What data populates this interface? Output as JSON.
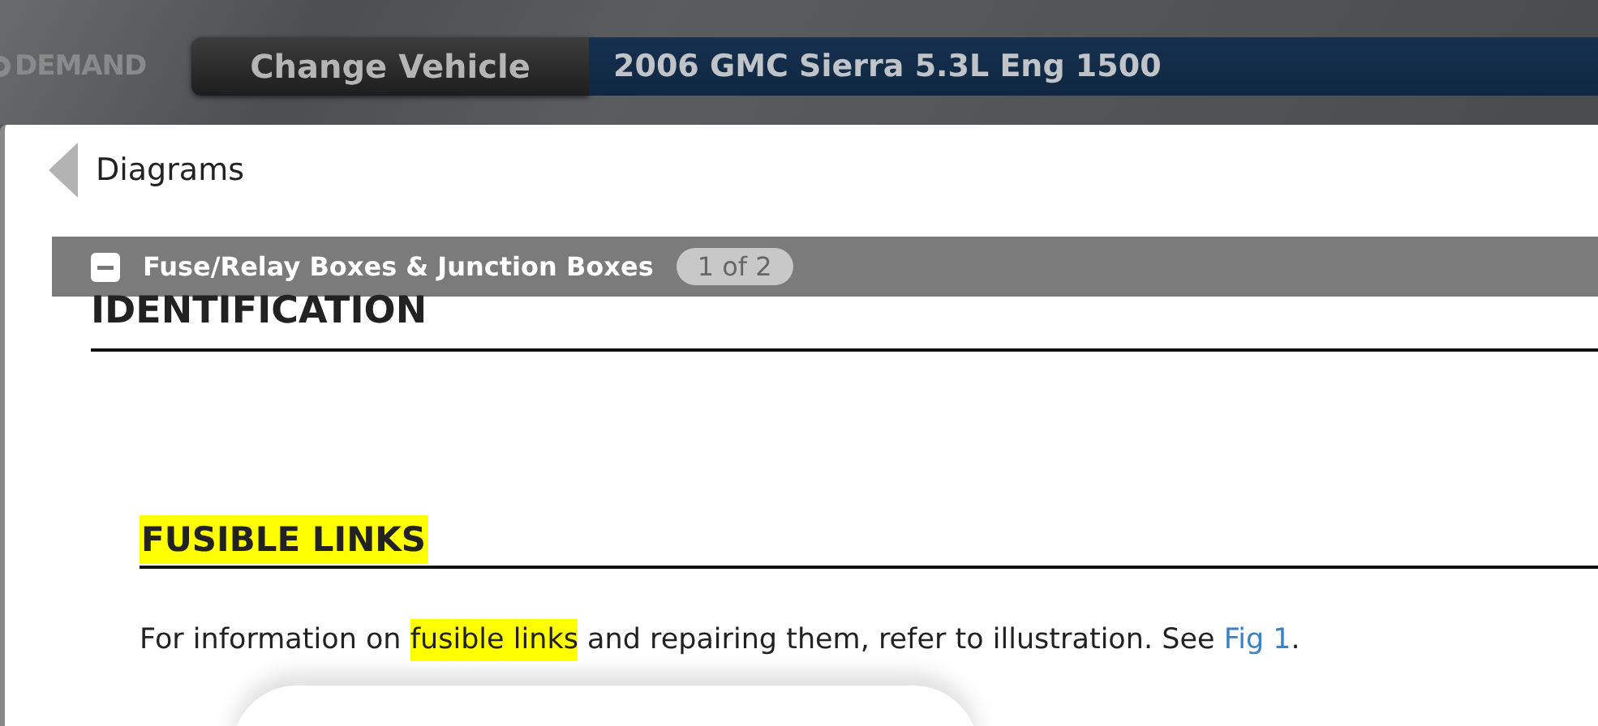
{
  "header": {
    "logo": "DEMAND",
    "change_vehicle_button": "Change Vehicle",
    "vehicle": "2006 GMC Sierra 5.3L Eng 1500"
  },
  "breadcrumb": {
    "label": "Diagrams"
  },
  "section": {
    "title": "Fuse/Relay Boxes & Junction Boxes",
    "expanded": true,
    "page_badge": "1 of 2"
  },
  "heading": "IDENTIFICATION",
  "subheading": "FUSIBLE LINKS",
  "paragraph": [
    {
      "kind": "text",
      "text": "For information on "
    },
    {
      "kind": "highlight",
      "text": "fusible links"
    },
    {
      "kind": "text",
      "text": " and repairing them, refer to illustration. See "
    },
    {
      "kind": "link",
      "text": "Fig 1"
    },
    {
      "kind": "text",
      "text": "."
    }
  ]
}
